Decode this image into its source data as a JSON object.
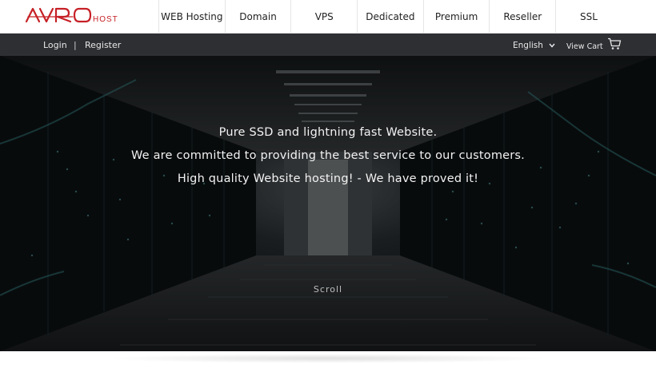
{
  "brand": {
    "logo_main": "AVRO",
    "logo_sub": "HOST",
    "accent_color": "#c62026"
  },
  "nav": {
    "items": [
      {
        "label": "WEB Hosting"
      },
      {
        "label": "Domain"
      },
      {
        "label": "VPS"
      },
      {
        "label": "Dedicated"
      },
      {
        "label": "Premium"
      },
      {
        "label": "Reseller"
      },
      {
        "label": "SSL"
      }
    ]
  },
  "subbar": {
    "login": "Login",
    "separator": "|",
    "register": "Register",
    "language": "English",
    "cart": "View Cart",
    "icons": [
      "chevron-down-icon",
      "shopping-cart-icon"
    ]
  },
  "hero": {
    "line1": "Pure SSD and lightning fast Website.",
    "line2": "We are committed to providing the best service to our customers.",
    "line3": "High quality Website hosting! - We have proved it!",
    "scroll": "Scroll"
  }
}
